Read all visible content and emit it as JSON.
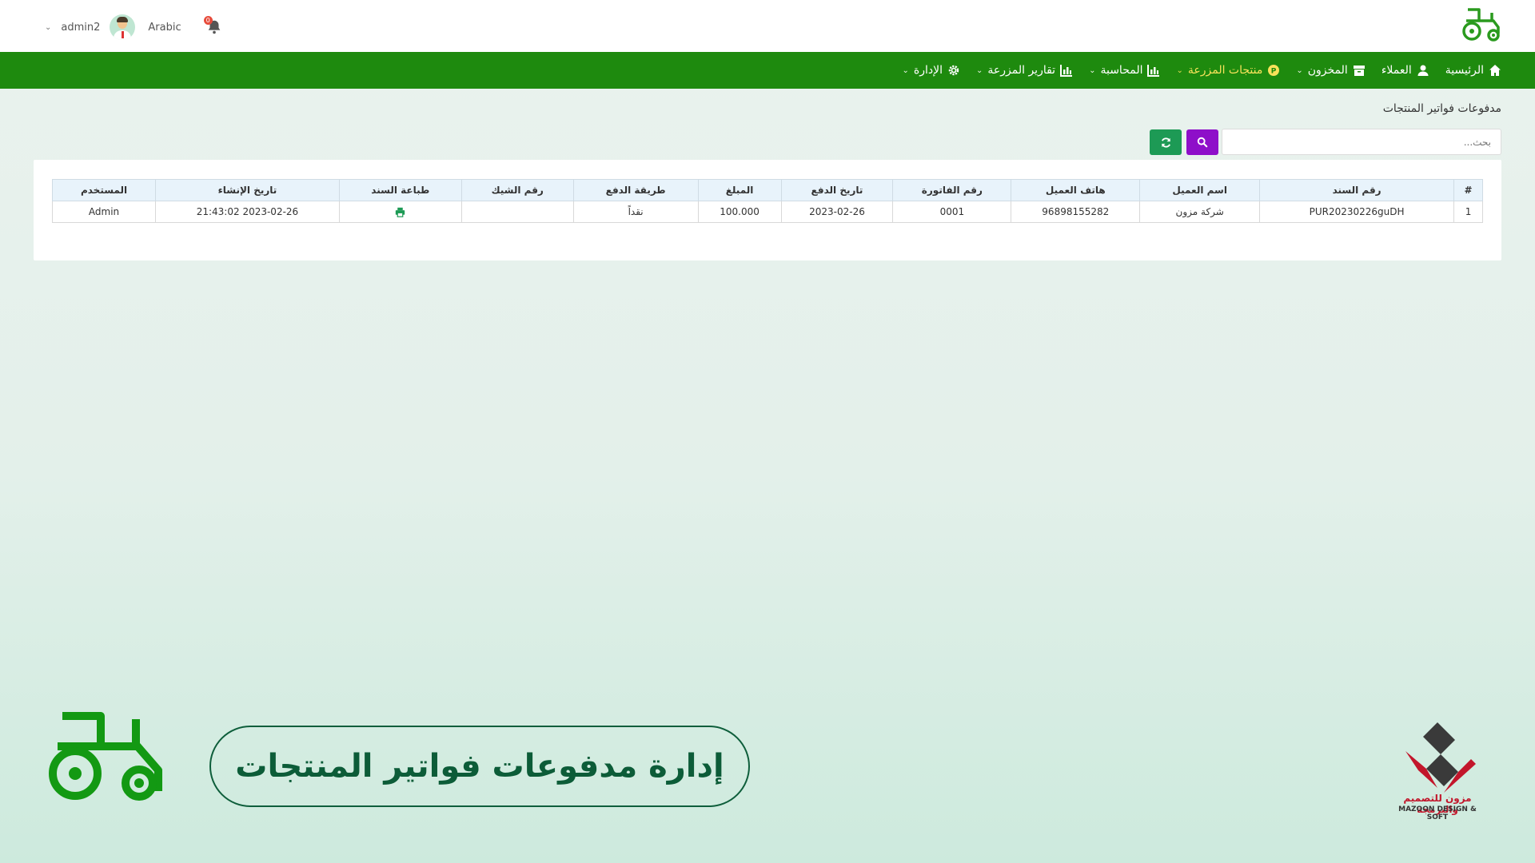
{
  "header": {
    "username": "admin2",
    "language": "Arabic",
    "notifications_count": "0"
  },
  "nav": {
    "items": [
      {
        "label": "الرئيسية",
        "icon": "home-icon",
        "has_dropdown": false
      },
      {
        "label": "العملاء",
        "icon": "user-icon",
        "has_dropdown": false
      },
      {
        "label": "المخزون",
        "icon": "archive-icon",
        "has_dropdown": true
      },
      {
        "label": "منتجات المزرعة",
        "icon": "product-icon",
        "has_dropdown": true
      },
      {
        "label": "المحاسبة",
        "icon": "chart-icon",
        "has_dropdown": true
      },
      {
        "label": "تقارير المزرعة",
        "icon": "chart-icon",
        "has_dropdown": true
      },
      {
        "label": "الإدارة",
        "icon": "gear-icon",
        "has_dropdown": true
      }
    ],
    "active_label": "منتجات المزرعة"
  },
  "page": {
    "title": "مدفوعات فواتير المنتجات"
  },
  "search": {
    "placeholder": "بحث..."
  },
  "table": {
    "headers": [
      "#",
      "رقم السند",
      "اسم العميل",
      "هاتف العميل",
      "رقم الفاتورة",
      "تاريخ الدفع",
      "المبلغ",
      "طريقة الدفع",
      "رقم الشيك",
      "طباعة السند",
      "تاريخ الإنشاء",
      "المستخدم"
    ],
    "rows": [
      {
        "index": "1",
        "voucher_no": "PUR20230226guDH",
        "customer_name": "شركة مزون",
        "customer_phone": "96898155282",
        "invoice_no": "0001",
        "payment_date": "2023-02-26",
        "amount": "100.000",
        "payment_method": "نقداً",
        "check_no": "",
        "created_at": "2023-02-26 21:43:02",
        "user": "Admin"
      }
    ]
  },
  "footer": {
    "banner_text": "إدارة مدفوعات فواتير المنتجات",
    "logo_ar": "مزون للتصميم والبرمجة",
    "logo_en": "MAZOON DESIGN & SOFT"
  },
  "colors": {
    "nav_green": "#1e8a0e",
    "active_nav": "#f7e25a",
    "search_button": "#8e0fc9",
    "refresh_button": "#1d9a55",
    "banner_green": "#0c5c38",
    "brand_red": "#c2162b"
  }
}
